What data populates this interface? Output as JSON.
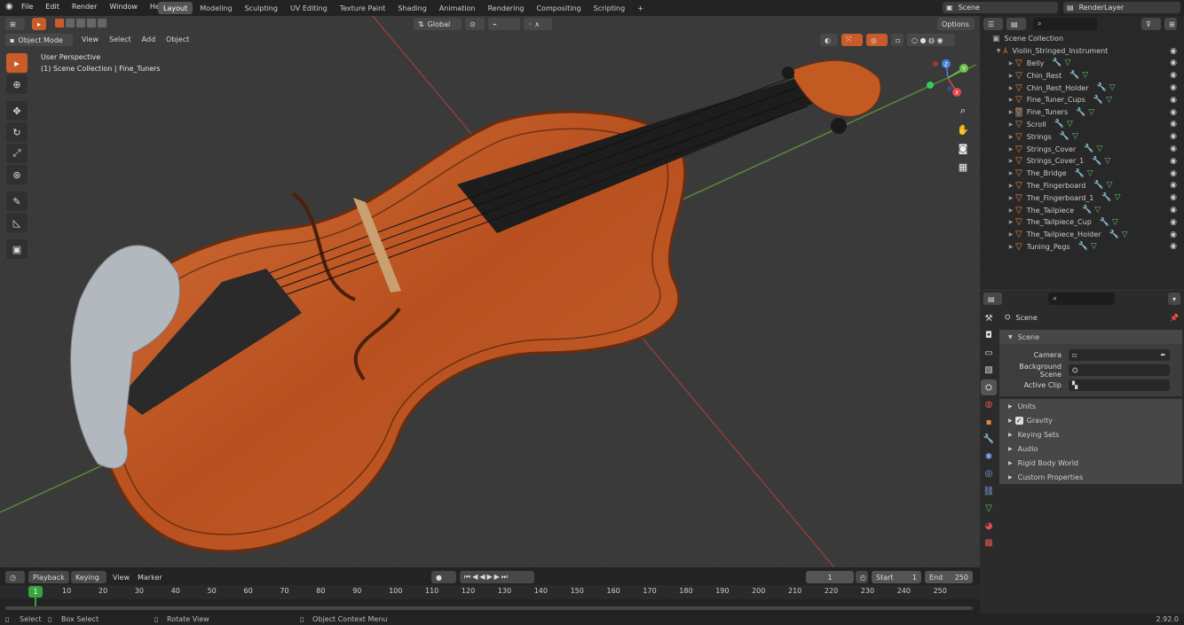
{
  "topbar": {
    "menu": [
      "File",
      "Edit",
      "Render",
      "Window",
      "Help"
    ],
    "workspaces": [
      "Layout",
      "Modeling",
      "Sculpting",
      "UV Editing",
      "Texture Paint",
      "Shading",
      "Animation",
      "Rendering",
      "Compositing",
      "Scripting"
    ],
    "active_workspace": "Layout",
    "add_tab": "+",
    "scene": "Scene",
    "render_layer": "RenderLayer"
  },
  "viewport": {
    "mode": "Object Mode",
    "menu": [
      "View",
      "Select",
      "Add",
      "Object"
    ],
    "orientation": "Global",
    "options": "Options",
    "perspective": "User Perspective",
    "collection_path": "(1) Scene Collection | Fine_Tuners",
    "gizmo_axes": [
      "X",
      "Y",
      "Z"
    ]
  },
  "outliner": {
    "root": "Scene Collection",
    "collection": "Violin_Stringed_Instrument",
    "objects": [
      "Belly",
      "Chin_Rest",
      "Chin_Rest_Holder",
      "Fine_Tuner_Cups",
      "Fine_Tuners",
      "Scroll",
      "Strings",
      "Strings_Cover",
      "Strings_Cover_1",
      "The_Bridge",
      "The_Fingerboard",
      "The_Fingerboard_1",
      "The_Tailpiece",
      "The_Tailpiece_Cup",
      "The_Tailpiece_Holder",
      "Tuning_Pegs"
    ],
    "selected": "Fine_Tuners"
  },
  "properties": {
    "context": "Scene",
    "panel": "Scene",
    "fields": [
      {
        "label": "Camera"
      },
      {
        "label": "Background Scene"
      },
      {
        "label": "Active Clip"
      }
    ],
    "sections": [
      "Units",
      "Gravity",
      "Keying Sets",
      "Audio",
      "Rigid Body World",
      "Custom Properties"
    ],
    "gravity_checked": true
  },
  "timeline": {
    "menu": [
      "Playback",
      "Keying",
      "View",
      "Marker"
    ],
    "current_frame": "1",
    "start_label": "Start",
    "start": "1",
    "end_label": "End",
    "end": "250",
    "ruler": [
      "10",
      "20",
      "30",
      "40",
      "50",
      "60",
      "70",
      "80",
      "90",
      "100",
      "110",
      "120",
      "130",
      "140",
      "150",
      "160",
      "170",
      "180",
      "190",
      "200",
      "210",
      "220",
      "230",
      "240",
      "250"
    ],
    "frame_marker": "1"
  },
  "statusbar": {
    "items": [
      "Select",
      "Box Select",
      "Rotate View",
      "Object Context Menu"
    ],
    "version": "2.92.0"
  },
  "colors": {
    "accent": "#ca5c2c",
    "selection": "#e7873b",
    "wood": "#c8622a",
    "timeline_marker": "#37a43e"
  }
}
